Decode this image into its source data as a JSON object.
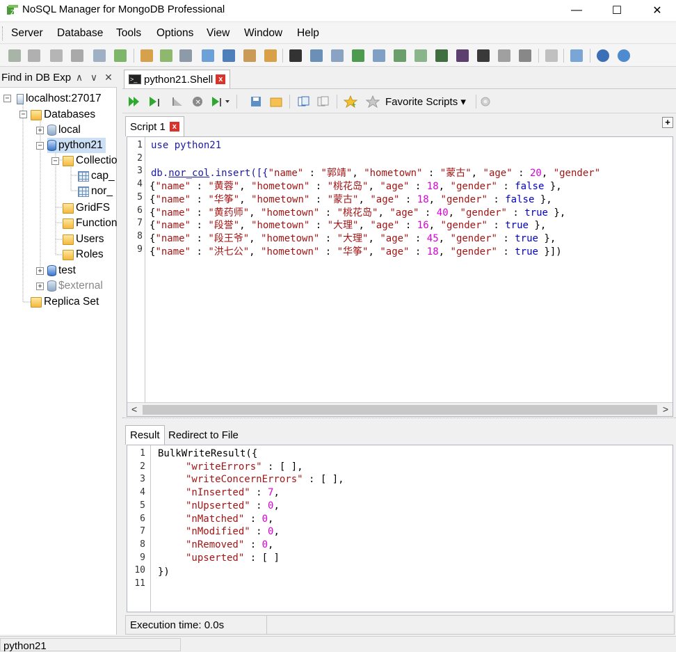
{
  "window": {
    "title": "NoSQL Manager for MongoDB Professional",
    "minimize": "—",
    "maximize": "☐",
    "close": "✕"
  },
  "menu": [
    "Server",
    "Database",
    "Tools",
    "Options",
    "View",
    "Window",
    "Help"
  ],
  "explorer": {
    "header": "Find in DB Explorer",
    "up": "∧",
    "down": "∨",
    "close": "✕",
    "tree": {
      "server": "localhost:27017",
      "databases": "Databases",
      "local": "local",
      "python21": "python21",
      "collections": "Collections",
      "col1": "cap_",
      "col2": "nor_",
      "gridfs": "GridFS",
      "functions": "Functions",
      "users": "Users",
      "roles": "Roles",
      "test": "test",
      "external": "$external",
      "replica": "Replica Set"
    }
  },
  "doc_tab": {
    "label": "python21.Shell",
    "close": "x"
  },
  "script_toolbar": {
    "favorites": "Favorite Scripts ▾"
  },
  "script_tab": {
    "label": "Script 1",
    "close": "x",
    "add": "+"
  },
  "editor": {
    "line_numbers": [
      "1",
      "2",
      "3",
      "4",
      "5",
      "6",
      "7",
      "8",
      "9"
    ],
    "line1": {
      "kw": "use",
      "rest": " python21"
    },
    "line3": {
      "db": "db.",
      "col": "nor_col",
      "call": ".insert([{",
      "k1": "\"name\"",
      "v1": "\"郭靖\"",
      "k2": "\"hometown\"",
      "v2": "\"蒙古\"",
      "k3": "\"age\"",
      "v3": "20",
      "k4": "\"gender\""
    },
    "rows": [
      {
        "name": "\"黄蓉\"",
        "home": "\"桃花岛\"",
        "age": "18",
        "gender": "false",
        "end": " },"
      },
      {
        "name": "\"华筝\"",
        "home": "\"蒙古\"",
        "age": "18",
        "gender": "false",
        "end": " },"
      },
      {
        "name": "\"黄药师\"",
        "home": "\"桃花岛\"",
        "age": "40",
        "gender": "true",
        "end": " },"
      },
      {
        "name": "\"段誉\"",
        "home": "\"大理\"",
        "age": "16",
        "gender": "true",
        "end": " },"
      },
      {
        "name": "\"段王爷\"",
        "home": "\"大理\"",
        "age": "45",
        "gender": "true",
        "end": " },"
      },
      {
        "name": "\"洪七公\"",
        "home": "\"华筝\"",
        "age": "18",
        "gender": "true",
        "end": " }])"
      }
    ],
    "keys": {
      "name": "\"name\"",
      "hometown": "\"hometown\"",
      "age": "\"age\"",
      "gender": "\"gender\""
    },
    "scroll_left": "<",
    "scroll_right": ">"
  },
  "result_tabs": [
    "Result",
    "Redirect to File"
  ],
  "result": {
    "line_numbers": [
      "1",
      "2",
      "3",
      "4",
      "5",
      "6",
      "7",
      "8",
      "9",
      "10",
      "11"
    ],
    "open": "BulkWriteResult({",
    "fields": [
      {
        "key": "\"writeErrors\"",
        "sep": " : ",
        "val": "[ ]",
        "tail": ",",
        "kind": "arr"
      },
      {
        "key": "\"writeConcernErrors\"",
        "sep": " : ",
        "val": "[ ]",
        "tail": ",",
        "kind": "arr"
      },
      {
        "key": "\"nInserted\"",
        "sep": " : ",
        "val": "7",
        "tail": ",",
        "kind": "num"
      },
      {
        "key": "\"nUpserted\"",
        "sep": " : ",
        "val": "0",
        "tail": ",",
        "kind": "num"
      },
      {
        "key": "\"nMatched\"",
        "sep": " : ",
        "val": "0",
        "tail": ",",
        "kind": "num"
      },
      {
        "key": "\"nModified\"",
        "sep": " : ",
        "val": "0",
        "tail": ",",
        "kind": "num"
      },
      {
        "key": "\"nRemoved\"",
        "sep": " : ",
        "val": "0",
        "tail": ",",
        "kind": "num"
      },
      {
        "key": "\"upserted\"",
        "sep": " : ",
        "val": "[ ]",
        "tail": "",
        "kind": "arr"
      }
    ],
    "close": "})"
  },
  "status": {
    "execution": "Execution time: 0.0s"
  },
  "bottom": {
    "db": "python21"
  }
}
